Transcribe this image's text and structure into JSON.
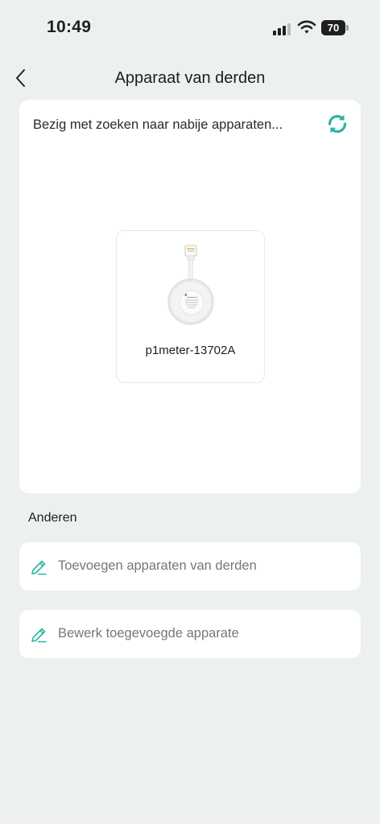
{
  "status_bar": {
    "time": "10:49",
    "battery": "70",
    "icons": [
      "cellular-signal-icon",
      "wifi-icon",
      "battery-icon"
    ]
  },
  "header": {
    "title": "Apparaat van derden",
    "back_icon": "chevron-left-icon"
  },
  "search": {
    "status_text": "Bezig met zoeken naar nabije apparaten...",
    "refresh_icon": "refresh-icon",
    "devices": [
      {
        "name": "p1meter-13702A",
        "icon": "p1-meter-device-image"
      }
    ]
  },
  "others": {
    "label": "Anderen",
    "actions": [
      {
        "label": "Toevoegen apparaten van derden",
        "icon": "pencil-icon"
      },
      {
        "label": "Bewerk toegevoegde apparate",
        "icon": "pencil-icon"
      }
    ]
  },
  "colors": {
    "background": "#ecf1f0",
    "card": "#ffffff",
    "accent_teal": "#2bb5a3",
    "muted_text": "#757878"
  }
}
